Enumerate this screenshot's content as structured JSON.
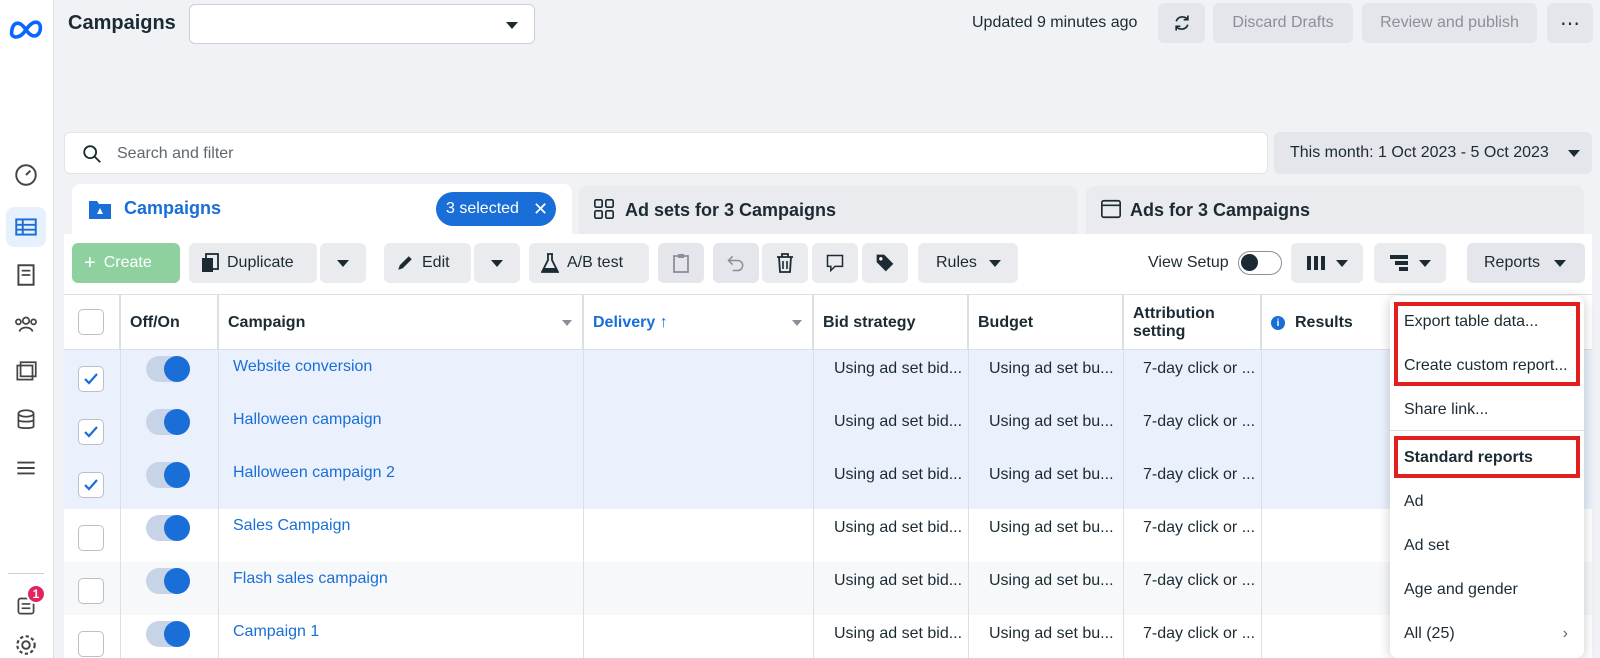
{
  "header": {
    "title": "Campaigns",
    "updated": "Updated 9 minutes ago",
    "discard": "Discard Drafts",
    "review": "Review and publish",
    "more": "⋯"
  },
  "search": {
    "placeholder": "Search and filter"
  },
  "date_range": "This month: 1 Oct 2023 - 5 Oct 2023",
  "tabs": {
    "campaigns": "Campaigns",
    "selected": "3 selected",
    "adsets": "Ad sets for 3 Campaigns",
    "ads": "Ads for 3 Campaigns"
  },
  "toolbar": {
    "create": "Create",
    "duplicate": "Duplicate",
    "edit": "Edit",
    "ab_test": "A/B test",
    "rules": "Rules",
    "view_setup": "View Setup",
    "reports": "Reports"
  },
  "columns": {
    "offon": "Off/On",
    "campaign": "Campaign",
    "delivery": "Delivery ↑",
    "bid": "Bid strategy",
    "budget": "Budget",
    "attribution": "Attribution setting",
    "results": "Results"
  },
  "rows": [
    {
      "name": "Website conversion",
      "bid": "Using ad set bid...",
      "budget": "Using ad set bu...",
      "attr": "7-day click or ...",
      "checked": true
    },
    {
      "name": "Halloween campaign",
      "bid": "Using ad set bid...",
      "budget": "Using ad set bu...",
      "attr": "7-day click or ...",
      "checked": true
    },
    {
      "name": "Halloween campaign 2",
      "bid": "Using ad set bid...",
      "budget": "Using ad set bu...",
      "attr": "7-day click or ...",
      "checked": true
    },
    {
      "name": "Sales Campaign",
      "bid": "Using ad set bid...",
      "budget": "Using ad set bu...",
      "attr": "7-day click or ...",
      "checked": false
    },
    {
      "name": "Flash sales campaign",
      "bid": "Using ad set bid...",
      "budget": "Using ad set bu...",
      "attr": "7-day click or ...",
      "checked": false
    },
    {
      "name": "Campaign 1",
      "bid": "Using ad set bid...",
      "budget": "Using ad set bu...",
      "attr": "7-day click or ...",
      "checked": false
    }
  ],
  "menu": {
    "export": "Export table data...",
    "custom": "Create custom report...",
    "share": "Share link...",
    "standard": "Standard reports",
    "ad": "Ad",
    "adset": "Ad set",
    "age": "Age and gender",
    "all": "All (25)"
  },
  "notifications": {
    "count": "1"
  },
  "colors": {
    "accent": "#1a6ed8",
    "highlight": "#e21e1e",
    "create_green": "#8fd19e"
  }
}
